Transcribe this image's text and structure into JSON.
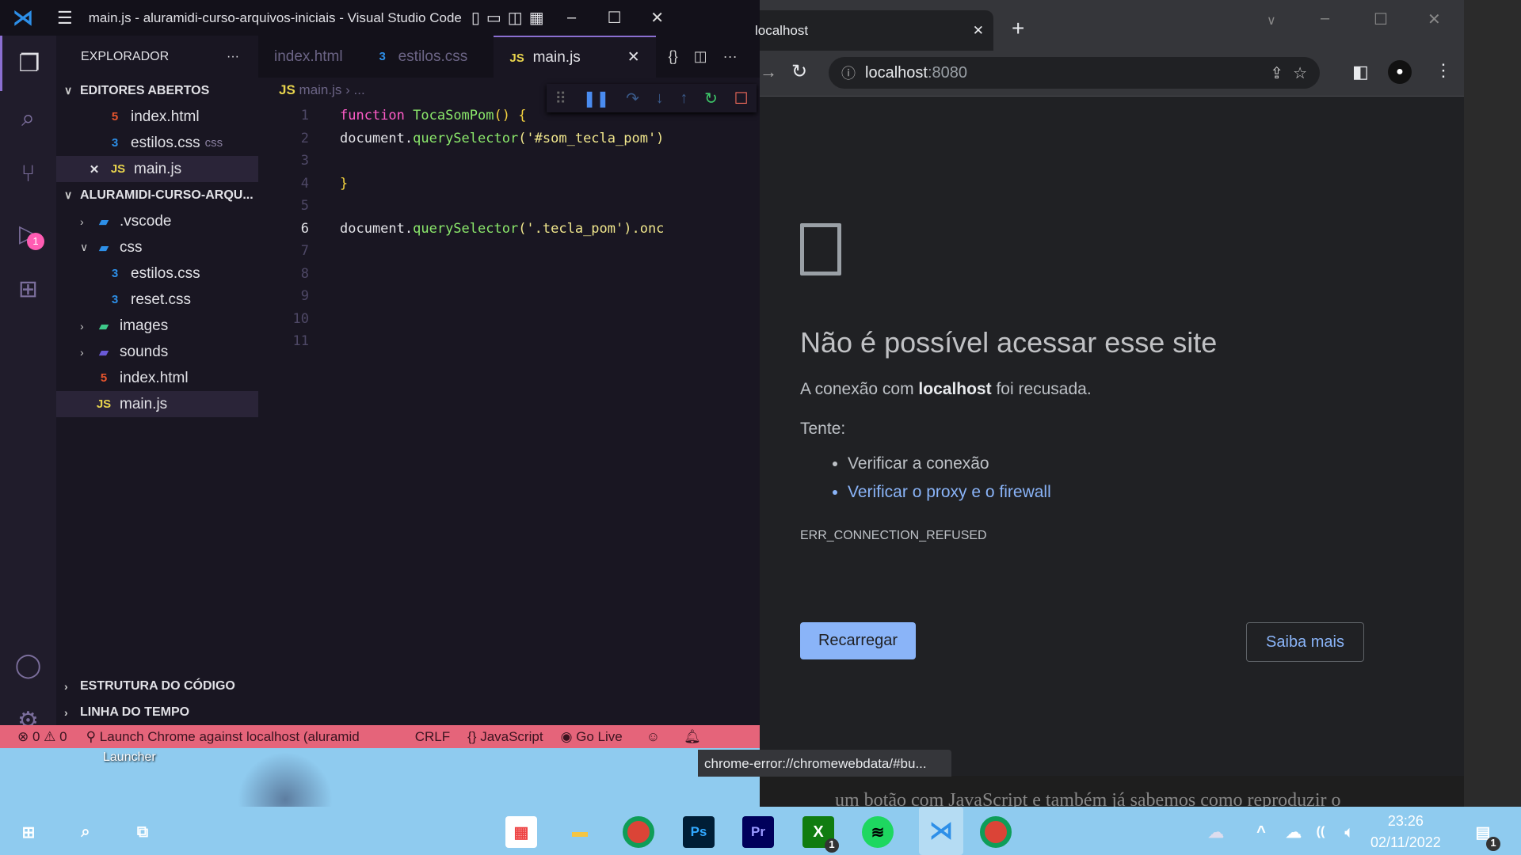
{
  "desktop": {
    "launcher_label": "Launcher",
    "background_text": "um botão com JavaScript e também já sabemos como reproduzir o"
  },
  "vscode": {
    "title": "main.js - aluramidi-curso-arquivos-iniciais - Visual Studio Code",
    "explorer_title": "EXPLORADOR",
    "debug_badge": "1",
    "open_editors_label": "EDITORES ABERTOS",
    "open_editors": [
      {
        "name": "index.html",
        "type": "html"
      },
      {
        "name": "estilos.css",
        "type": "css",
        "hint": "css"
      },
      {
        "name": "main.js",
        "type": "js"
      }
    ],
    "project_label": "ALURAMIDI-CURSO-ARQU...",
    "tree": [
      ".vscode",
      "css",
      "estilos.css",
      "reset.css",
      "images",
      "sounds",
      "index.html",
      "main.js"
    ],
    "outline_label": "ESTRUTURA DO CÓDIGO",
    "timeline_label": "LINHA DO TEMPO",
    "tabs": [
      "index.html",
      "estilos.css",
      "main.js"
    ],
    "breadcrumb": {
      "file": "main.js",
      "rest": "..."
    },
    "code": {
      "l1a": "function",
      "l1b": "TocaSomPom",
      "l1c": " () {",
      "l2a": "document.",
      "l2b": "querySelector",
      "l2c": "('#som_tecla_pom')",
      "l4": "}",
      "l6a": "document.",
      "l6b": "querySelector",
      "l6c": "('.tecla_pom').onc",
      "line_numbers": [
        "1",
        "2",
        "3",
        "4",
        "5",
        "6",
        "7",
        "8",
        "9",
        "10",
        "11"
      ]
    },
    "status": {
      "errors": "0",
      "warnings": "0",
      "launch": "Launch Chrome against localhost (aluramid",
      "eol": "CRLF",
      "language": "JavaScript",
      "golive": "Go Live"
    }
  },
  "browser": {
    "tab_title": "localhost",
    "url_host": "localhost",
    "url_port": ":8080",
    "heading": "Não é possível acessar esse site",
    "msg_pre": "A conexão com ",
    "msg_bold": "localhost",
    "msg_post": " foi recusada.",
    "try_label": "Tente:",
    "suggestions": [
      "Verificar a conexão",
      "Verificar o proxy e o firewall"
    ],
    "error_code": "ERR_CONNECTION_REFUSED",
    "reload_button": "Recarregar",
    "learn_more_button": "Saiba mais",
    "status_url": "chrome-error://chromewebdata/#bu..."
  },
  "taskbar": {
    "time": "23:26",
    "date": "02/11/2022",
    "xbox_badge": "1",
    "notification_count": "1"
  },
  "colors": {
    "vscode_bg": "#191622",
    "statusbar": "#e5647a",
    "chrome_bg": "#202124",
    "link": "#8ab4f8"
  }
}
